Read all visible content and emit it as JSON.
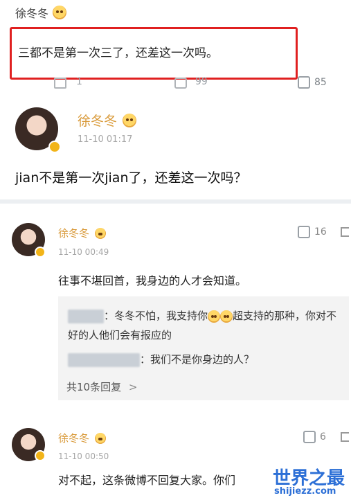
{
  "comment1": {
    "name": "徐冬冬",
    "text": "三都不是第一次三了，还差这一次吗。",
    "comment_count": "1",
    "repost_count": "99",
    "like_count": "85"
  },
  "comment2": {
    "name": "徐冬冬",
    "time": "11-10 01:17",
    "text": "jian不是第一次jian了，还差这一次吗？"
  },
  "comment3": {
    "name": "徐冬冬",
    "time": "11-10 00:49",
    "likes": "16",
    "text": "往事不堪回首，我身边的人才会知道。",
    "replies": [
      {
        "text": "：冬冬不怕，我支持你",
        "text2": "超支持的那种，你对不好的人他们会有报应的"
      },
      {
        "text": "：我们不是你身边的人？"
      }
    ],
    "more_replies": "共10条回复",
    "more_chevron": ">"
  },
  "comment4": {
    "name": "徐冬冬",
    "time": "11-10 00:50",
    "likes": "6",
    "text": "对不起，这条微博不回复大家。你们"
  },
  "watermark": {
    "title": "世界之最",
    "url": "shijiezz.com"
  },
  "colors": {
    "highlight_border": "#e02020",
    "name_orange": "#d99a3a",
    "watermark_blue": "#2c6fd6"
  }
}
